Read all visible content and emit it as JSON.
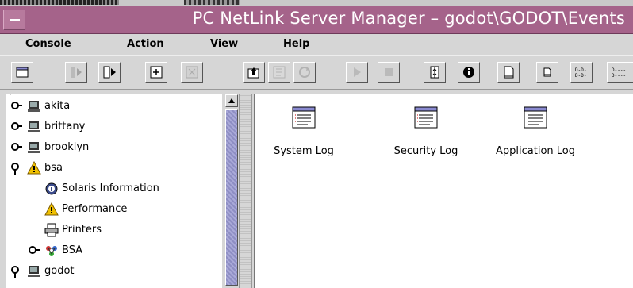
{
  "window": {
    "title": "PC NetLink Server Manager – godot\\GODOT\\Events"
  },
  "menubar": [
    {
      "label": "Console",
      "underline": "C"
    },
    {
      "label": "Action",
      "underline": "A"
    },
    {
      "label": "View",
      "underline": "V"
    },
    {
      "label": "Help",
      "underline": "H"
    }
  ],
  "toolbar": [
    {
      "name": "console-icon",
      "enabled": true
    },
    {
      "name": "disconnect-icon",
      "enabled": false
    },
    {
      "name": "connect-icon",
      "enabled": true
    },
    {
      "name": "add-server-icon",
      "enabled": true
    },
    {
      "name": "remove-server-icon",
      "enabled": false
    },
    {
      "name": "up-level-icon",
      "enabled": true
    },
    {
      "name": "properties-icon",
      "enabled": false
    },
    {
      "name": "refresh-icon",
      "enabled": false
    },
    {
      "name": "play-icon",
      "enabled": false
    },
    {
      "name": "stop-icon",
      "enabled": false
    },
    {
      "name": "split-pane-icon",
      "enabled": true
    },
    {
      "name": "info-icon",
      "enabled": true
    },
    {
      "name": "large-icons-view-icon",
      "enabled": true
    },
    {
      "name": "small-icons-view-icon",
      "enabled": true
    },
    {
      "name": "list-view-icon",
      "enabled": true
    },
    {
      "name": "details-view-icon",
      "enabled": true
    }
  ],
  "tree": [
    {
      "label": "akita",
      "icon": "computer-icon",
      "state": "collapsed",
      "level": 0
    },
    {
      "label": "brittany",
      "icon": "computer-icon",
      "state": "collapsed",
      "level": 0
    },
    {
      "label": "brooklyn",
      "icon": "computer-icon",
      "state": "collapsed",
      "level": 0
    },
    {
      "label": "bsa",
      "icon": "warning-icon",
      "state": "expanded",
      "level": 0
    },
    {
      "label": "Solaris Information",
      "icon": "solaris-info-icon",
      "state": "leaf",
      "level": 1
    },
    {
      "label": "Performance",
      "icon": "warning-icon",
      "state": "leaf",
      "level": 1
    },
    {
      "label": "Printers",
      "icon": "printer-icon",
      "state": "leaf",
      "level": 1
    },
    {
      "label": "BSA",
      "icon": "network-icon",
      "state": "collapsed",
      "level": 1
    },
    {
      "label": "godot",
      "icon": "computer-icon",
      "state": "expanded",
      "level": 0
    }
  ],
  "logs": [
    {
      "label": "System Log",
      "icon": "log-file-icon"
    },
    {
      "label": "Security Log",
      "icon": "log-file-icon"
    },
    {
      "label": "Application Log",
      "icon": "log-file-icon"
    }
  ],
  "colors": {
    "titlebar": "#a5638a",
    "scroll_thumb": "#9a9ad0",
    "window_bg": "#d6d6d6"
  }
}
